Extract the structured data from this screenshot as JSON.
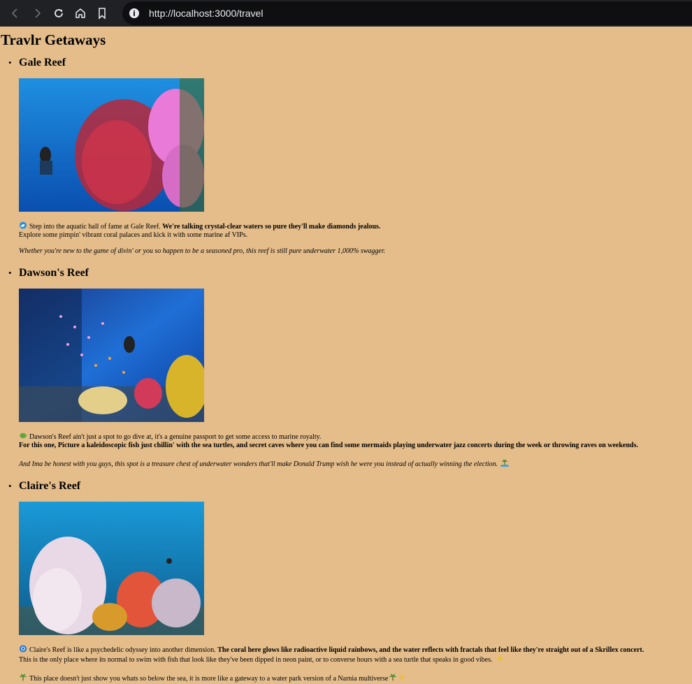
{
  "browser": {
    "url": "http://localhost:3000/travel"
  },
  "page": {
    "title": "Travlr Getaways"
  },
  "places": [
    {
      "name": "Gale Reef",
      "image_alt": "Scuba diver beside red sea fan and pink soft coral",
      "icon": "wave-icon",
      "desc_plain": "Step into the aquatic hall of fame at Gale Reef. ",
      "desc_bold": "We're talking crystal-clear waters so pure they'll make diamonds jealous.",
      "desc_line2": "Explore some pimpin' vibrant coral palaces and kick it with some marine af VIPs.",
      "italic": "Whether you're new to the game of divin' or you so happen to be a seasoned pro, this reef is still pure underwater 1,000% swagger."
    },
    {
      "name": "Dawson's Reef",
      "image_alt": "Scuba diver among schools of fish and yellow coral",
      "icon": "turtle-icon",
      "desc_plain": "Dawson's Reef ain't just a spot to go dive at, it's a genuine passport to get some access to marine royalty.",
      "desc_bold": "For this one, Picture a kaleidoscopic fish just chillin' with the sea turtles, and secret caves where you can find some mermaids playing underwater jazz concerts during the week or throwing raves on weekends.",
      "italic": "And Ima be honest with you guys, this spot is a treasure chest of underwater wonders that'll make Donald Trump wish he were you instead of actually winning the election.",
      "italic_icon": "island-icon"
    },
    {
      "name": "Claire's Reef",
      "image_alt": "Pale pink and orange soft corals in blue water",
      "icon": "disc-icon",
      "desc_plain": "Claire's Reef is like a psychedelic odyssey into another dimension. ",
      "desc_bold": "The coral here glows like radioactive liquid rainbows, and the water reflects with fractals that feel like they're straight out of a Skrillex concert.",
      "desc_line2": "This is the only place where its normal to swim with fish that look like they've been dipped in neon paint, or to converse hours with a sea turtle that speaks in good vibes.",
      "line2_icon": "sparkles-icon",
      "desc_line3": "This place doesn't just show you whats so below the sea, it is more like a gateway to a water park version of a Narnia multiverse",
      "line3_icon_before": "palm-icon",
      "line3_icons_after": [
        "palm-icon",
        "sparkles-icon"
      ]
    }
  ]
}
